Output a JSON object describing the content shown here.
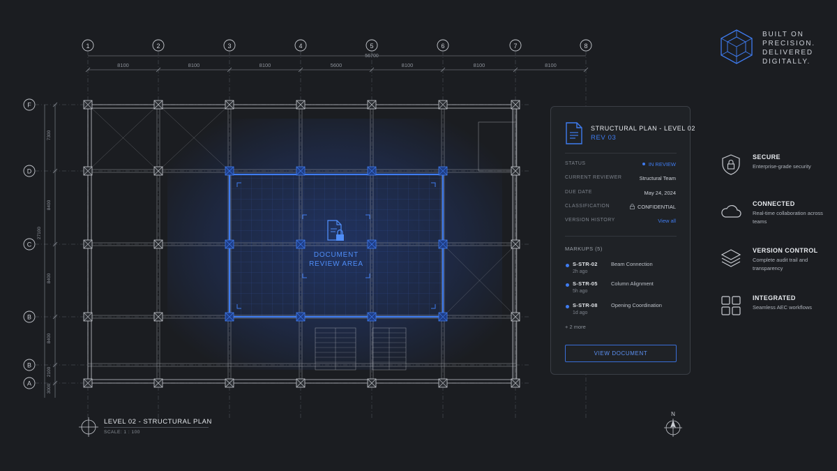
{
  "grid_columns": [
    "1",
    "2",
    "3",
    "4",
    "5",
    "6",
    "7",
    "8"
  ],
  "grid_rows": [
    "F",
    "D",
    "C",
    "B",
    "B",
    "A"
  ],
  "dimensions": {
    "total": "56700",
    "spans": [
      "8100",
      "8100",
      "8100",
      "5600",
      "8100",
      "8100",
      "8100"
    ],
    "vertical_spans": [
      "7300",
      "8400",
      "8400",
      "8400",
      "2100",
      "3000"
    ],
    "vertical_total": "27100"
  },
  "review_area": {
    "line1": "DOCUMENT",
    "line2": "REVIEW AREA"
  },
  "panel": {
    "title": "STRUCTURAL PLAN - LEVEL 02",
    "revision": "REV 03",
    "rows": [
      {
        "label": "STATUS",
        "value": "IN REVIEW"
      },
      {
        "label": "CURRENT REVIEWER",
        "value": "Structural Team"
      },
      {
        "label": "DUE DATE",
        "value": "May 24, 2024"
      },
      {
        "label": "CLASSIFICATION",
        "value": "CONFIDENTIAL"
      },
      {
        "label": "VERSION HISTORY",
        "value": "View all"
      }
    ],
    "markups_title": "MARKUPS (5)",
    "markups": [
      {
        "code": "S-STR-02",
        "time": "2h ago",
        "desc": "Beam Connection"
      },
      {
        "code": "S-STR-05",
        "time": "5h ago",
        "desc": "Column Alignment"
      },
      {
        "code": "S-STR-08",
        "time": "1d ago",
        "desc": "Opening Coordination"
      }
    ],
    "more": "+ 2 more",
    "button": "VIEW DOCUMENT"
  },
  "tagline": "BUILT ON PRECISION. DELIVERED DIGITALLY.",
  "features": [
    {
      "title": "SECURE",
      "desc": "Enterprise-grade security",
      "icon": "shield-lock-icon"
    },
    {
      "title": "CONNECTED",
      "desc": "Real-time collaboration across teams",
      "icon": "cloud-icon"
    },
    {
      "title": "VERSION CONTROL",
      "desc": "Complete audit trail and transparency",
      "icon": "layers-icon"
    },
    {
      "title": "INTEGRATED",
      "desc": "Seamless AEC workflows",
      "icon": "grid-icon"
    }
  ],
  "plan_label": {
    "title": "LEVEL 02 - STRUCTURAL PLAN",
    "scale": "SCALE: 1 : 100"
  },
  "north_label": "N",
  "colors": {
    "accent": "#3f7cf0",
    "background": "#1b1d21",
    "line": "#c9ccd2"
  }
}
